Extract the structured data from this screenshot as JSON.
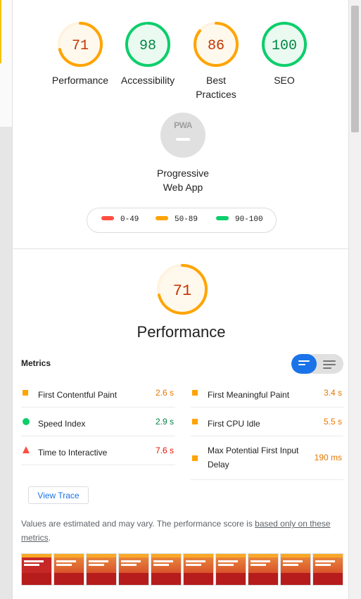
{
  "gauges": [
    {
      "score": "71",
      "label": "Performance",
      "color": "#ffa400",
      "fill": "#fff8ec",
      "fraction": 0.71
    },
    {
      "score": "98",
      "label": "Accessibility",
      "color": "#0cce6b",
      "fill": "#eafaf1",
      "fraction": 0.98
    },
    {
      "score": "86",
      "label_line1": "Best",
      "label_line2": "Practices",
      "color": "#ffa400",
      "fill": "#fff8ec",
      "fraction": 0.86
    },
    {
      "score": "100",
      "label": "SEO",
      "color": "#0cce6b",
      "fill": "#eafaf1",
      "fraction": 1.0
    }
  ],
  "pwa": {
    "badge": "PWA",
    "label_line1": "Progressive",
    "label_line2": "Web App"
  },
  "legend": [
    {
      "range": "0-49",
      "color": "#ff4e42"
    },
    {
      "range": "50-89",
      "color": "#ffa400"
    },
    {
      "range": "90-100",
      "color": "#0cce6b"
    }
  ],
  "performance": {
    "score": "71",
    "title": "Performance",
    "fraction": 0.71
  },
  "metrics": {
    "header": "Metrics",
    "left": [
      {
        "name": "First Contentful Paint",
        "value": "2.6 s",
        "status": "average",
        "color": "#e67700"
      },
      {
        "name": "Speed Index",
        "value": "2.9 s",
        "status": "pass",
        "color": "#018642"
      },
      {
        "name": "Time to Interactive",
        "value": "7.6 s",
        "status": "fail",
        "color": "#eb0f00"
      }
    ],
    "right": [
      {
        "name": "First Meaningful Paint",
        "value": "3.4 s",
        "status": "average",
        "color": "#e67700"
      },
      {
        "name": "First CPU Idle",
        "value": "5.5 s",
        "status": "average",
        "color": "#e67700"
      },
      {
        "name_line1": "Max Potential First Input",
        "name_line2": "Delay",
        "value": "190 ms",
        "status": "average",
        "color": "#e67700"
      }
    ]
  },
  "view_trace": "View Trace",
  "note": {
    "text": "Values are estimated and may vary. The performance score is ",
    "link_line1": "based only on these",
    "link_line2": "metrics",
    "end": "."
  },
  "colors": {
    "accent": "#1a73e8",
    "average": "#ffa400",
    "pass": "#0cce6b",
    "fail": "#ff4e42"
  }
}
